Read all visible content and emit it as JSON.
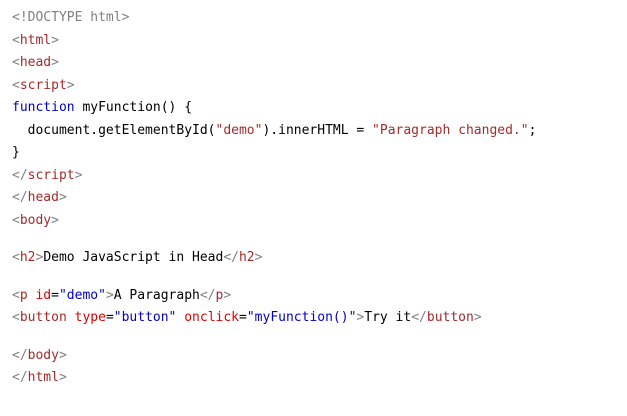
{
  "code": {
    "doctype": "DOCTYPE html",
    "html_open": "html",
    "head_open": "head",
    "script_open": "script",
    "fn_keyword": "function",
    "fn_signature": " myFunction() {",
    "stmt_indent": "  ",
    "stmt_call": "document.getElementById(",
    "stmt_arg": "\"demo\"",
    "stmt_mid": ").innerHTML = ",
    "stmt_value": "\"Paragraph changed.\"",
    "stmt_end": ";",
    "fn_close": "}",
    "script_close": "script",
    "head_close": "head",
    "body_open": "body",
    "h2_tag": "h2",
    "h2_text": "Demo JavaScript in Head",
    "p_tag": "p",
    "p_attr_name": "id",
    "p_attr_value": "\"demo\"",
    "p_text": "A Paragraph",
    "button_tag": "button",
    "button_attr1_name": "type",
    "button_attr1_value": "\"button\"",
    "button_attr2_name": "onclick",
    "button_attr2_value": "\"myFunction()\"",
    "button_text": "Try it",
    "body_close": "body",
    "html_close": "html"
  },
  "colors": {
    "punctuation": "#808080",
    "tag_name": "#a52a2a",
    "attribute_name": "#e00000",
    "attribute_value": "#0000cd",
    "keyword": "#0000cd",
    "text": "#000000"
  }
}
